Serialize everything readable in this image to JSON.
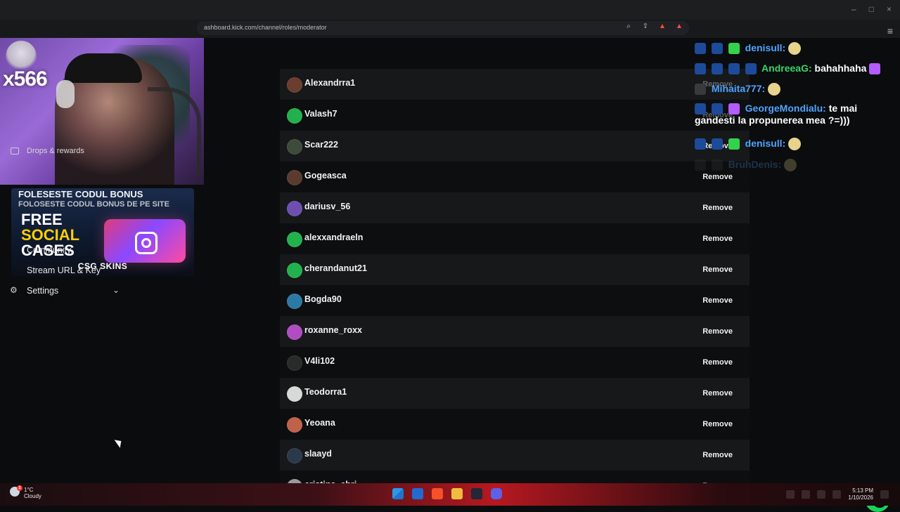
{
  "browser": {
    "url": "ashboard.kick.com/channel/roles/moderator",
    "window_controls": [
      "–",
      "□",
      "×"
    ]
  },
  "sidebar": {
    "drops_label": "Drops & rewards",
    "community_label": "Community",
    "stream_label": "Stream URL & Key",
    "settings_label": "Settings"
  },
  "webcam": {
    "counter": "x566"
  },
  "promo": {
    "line1": "FOLESESTE CODUL BONUS",
    "line2": "FOLOSESTE CODUL BONUS DE PE SITE",
    "free": "FREE",
    "social": "SOCIAL",
    "cases": "CASES",
    "brand": "CSG SKINS"
  },
  "moderators": {
    "rows": [
      {
        "name": "Alexandrra1",
        "remove": "Remove"
      },
      {
        "name": "Valash7",
        "remove": "Remove"
      },
      {
        "name": "Scar222",
        "remove": "Remove"
      },
      {
        "name": "Gogeasca",
        "remove": "Remove"
      },
      {
        "name": "dariusv_56",
        "remove": "Remove"
      },
      {
        "name": "alexxandraeln",
        "remove": "Remove"
      },
      {
        "name": "cherandanut21",
        "remove": "Remove"
      },
      {
        "name": "Bogda90",
        "remove": "Remove"
      },
      {
        "name": "roxanne_roxx",
        "remove": "Remove"
      },
      {
        "name": "V4li102",
        "remove": "Remove"
      },
      {
        "name": "Teodorra1",
        "remove": "Remove"
      },
      {
        "name": "Yeoana",
        "remove": "Remove"
      },
      {
        "name": "slaayd",
        "remove": "Remove"
      },
      {
        "name": "cristina_chri",
        "remove": "Remove"
      }
    ]
  },
  "chat": {
    "lines": [
      {
        "user": "denisull:",
        "message": "",
        "emoji": true
      },
      {
        "user": "AndreeaG:",
        "message": "bahahhaha",
        "emoji": false
      },
      {
        "user": "Mihaita777:",
        "message": "",
        "emoji": true
      },
      {
        "user": "GeorgeMondialu:",
        "message": "te mai gandesti la propunerea mea ?=)))",
        "emoji": false
      },
      {
        "user": "denisull:",
        "message": "",
        "emoji": true
      },
      {
        "user": "BruhDenis:",
        "message": "",
        "emoji": true
      }
    ]
  },
  "taskbar": {
    "weather_temp": "1°C",
    "weather_desc": "Cloudy",
    "notif_count": "1",
    "time": "5:13 PM",
    "date": "1/10/2026"
  }
}
